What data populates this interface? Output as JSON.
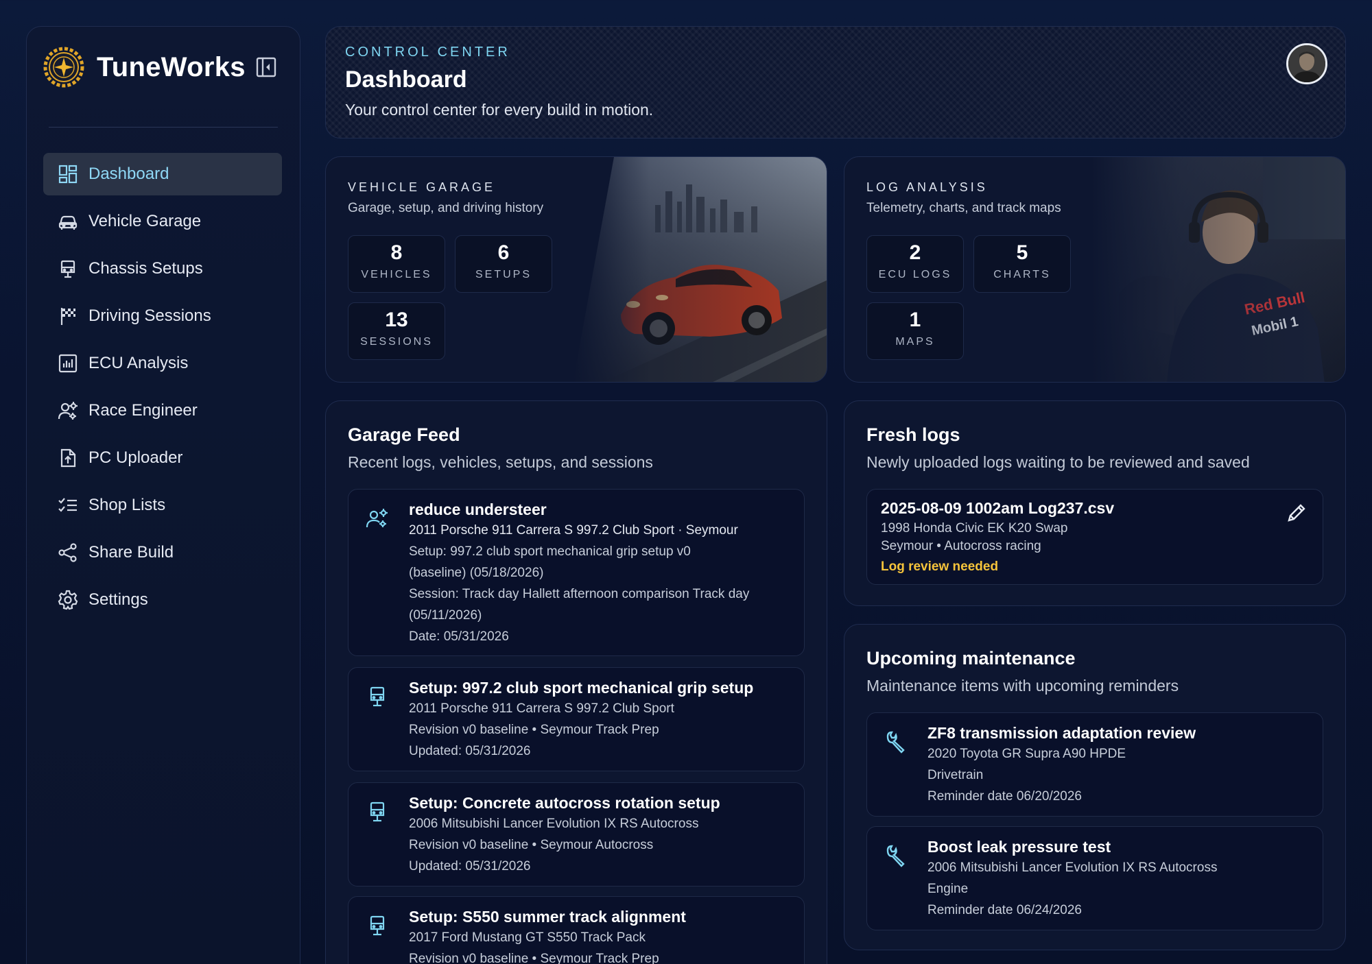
{
  "app": {
    "name": "TuneWorks"
  },
  "sidebar": {
    "items": [
      {
        "label": "Dashboard",
        "icon": "dashboard-icon",
        "active": true
      },
      {
        "label": "Vehicle Garage",
        "icon": "car-icon"
      },
      {
        "label": "Chassis Setups",
        "icon": "chassis-icon"
      },
      {
        "label": "Driving Sessions",
        "icon": "checkered-flag-icon"
      },
      {
        "label": "ECU Analysis",
        "icon": "chart-icon"
      },
      {
        "label": "Race Engineer",
        "icon": "engineer-icon"
      },
      {
        "label": "PC Uploader",
        "icon": "upload-icon"
      },
      {
        "label": "Shop Lists",
        "icon": "checklist-icon"
      },
      {
        "label": "Share Build",
        "icon": "share-icon"
      },
      {
        "label": "Settings",
        "icon": "gear-icon"
      }
    ]
  },
  "header": {
    "eyebrow": "CONTROL CENTER",
    "title": "Dashboard",
    "subtitle": "Your control center for every build in motion."
  },
  "garage": {
    "eyebrow": "VEHICLE GARAGE",
    "subtitle": "Garage, setup, and driving history",
    "stats": [
      {
        "num": "8",
        "label": "VEHICLES"
      },
      {
        "num": "6",
        "label": "SETUPS"
      },
      {
        "num": "13",
        "label": "SESSIONS"
      }
    ]
  },
  "logs": {
    "eyebrow": "LOG ANALYSIS",
    "subtitle": "Telemetry, charts, and track maps",
    "stats": [
      {
        "num": "2",
        "label": "ECU LOGS"
      },
      {
        "num": "5",
        "label": "CHARTS"
      },
      {
        "num": "1",
        "label": "MAPS"
      }
    ]
  },
  "feed": {
    "title": "Garage Feed",
    "subtitle": "Recent logs, vehicles, setups, and sessions",
    "items": [
      {
        "title": "reduce understeer",
        "lines": [
          "2011 Porsche 911 Carrera S 997.2 Club Sport · Seymour",
          "Setup: 997.2 club sport mechanical grip setup v0",
          "(baseline) (05/18/2026)",
          "Session: Track day Hallett afternoon comparison Track day",
          "(05/11/2026)",
          "Date: 05/31/2026"
        ]
      },
      {
        "title": "Setup: 997.2 club sport mechanical grip setup",
        "lines": [
          "2011 Porsche 911 Carrera S 997.2 Club Sport",
          "Revision v0 baseline • Seymour Track Prep",
          "Updated: 05/31/2026"
        ]
      },
      {
        "title": "Setup: Concrete autocross rotation setup",
        "lines": [
          "2006 Mitsubishi Lancer Evolution IX RS Autocross",
          "Revision v0 baseline • Seymour Autocross",
          "Updated: 05/31/2026"
        ]
      },
      {
        "title": "Setup: S550 summer track alignment",
        "lines": [
          "2017 Ford Mustang GT S550 Track Pack",
          "Revision v0 baseline • Seymour Track Prep"
        ]
      }
    ]
  },
  "fresh": {
    "title": "Fresh logs",
    "subtitle": "Newly uploaded logs waiting to be reviewed and saved",
    "entry": {
      "filename": "2025-08-09 1002am Log237.csv",
      "vehicle": "1998 Honda Civic EK K20 Swap",
      "context": "Seymour • Autocross racing",
      "status": "Log review needed"
    }
  },
  "maintenance": {
    "title": "Upcoming maintenance",
    "subtitle": "Maintenance items with upcoming reminders",
    "items": [
      {
        "title": "ZF8 transmission adaptation review",
        "lines": [
          "2020 Toyota GR Supra A90 HPDE",
          "Drivetrain",
          "Reminder date 06/20/2026"
        ]
      },
      {
        "title": "Boost leak pressure test",
        "lines": [
          "2006 Mitsubishi Lancer Evolution IX RS Autocross",
          "Engine",
          "Reminder date 06/24/2026"
        ]
      }
    ]
  },
  "colors": {
    "accent": "#7fd6f2",
    "warning": "#f5c33b",
    "brand_gold": "#e0a528"
  }
}
